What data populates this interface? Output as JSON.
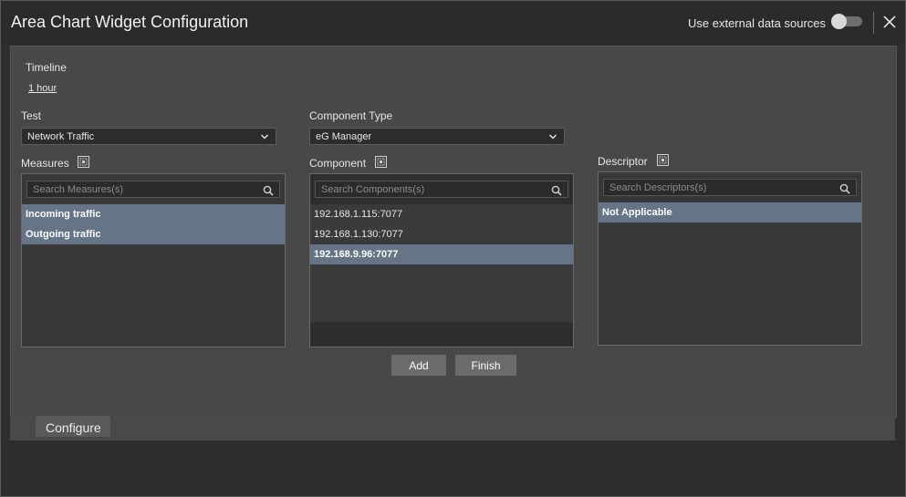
{
  "window": {
    "title": "Area Chart Widget Configuration",
    "external_sources_label": "Use external data sources",
    "external_sources_enabled": false
  },
  "timeline": {
    "label": "Timeline",
    "value": "1 hour"
  },
  "test": {
    "label": "Test",
    "selected": "Network Traffic"
  },
  "component_type": {
    "label": "Component Type",
    "selected": "eG Manager"
  },
  "measures": {
    "label": "Measures",
    "search_placeholder": "Search Measures(s)",
    "items": [
      {
        "label": "Incoming traffic",
        "selected": true
      },
      {
        "label": "Outgoing traffic",
        "selected": true
      }
    ]
  },
  "component": {
    "label": "Component",
    "search_placeholder": "Search Components(s)",
    "items": [
      {
        "label": "192.168.1.115:7077",
        "selected": false
      },
      {
        "label": "192.168.1.130:7077",
        "selected": false
      },
      {
        "label": "192.168.9.96:7077",
        "selected": true
      }
    ]
  },
  "descriptor": {
    "label": "Descriptor",
    "search_placeholder": "Search Descriptors(s)",
    "items": [
      {
        "label": "Not Applicable",
        "selected": true
      }
    ]
  },
  "buttons": {
    "add": "Add",
    "finish": "Finish"
  },
  "tabs": [
    {
      "label": "Configure",
      "active": true
    }
  ],
  "colors": {
    "selection": "#667487",
    "panel": "#484848",
    "titlebar": "#2b2b2b",
    "button": "#6b6b6b"
  },
  "icons": {
    "close": "close-icon",
    "toggle": "toggle-switch",
    "expand": "expand-icon",
    "search": "search-icon",
    "dropdown": "chevron-down-icon"
  }
}
